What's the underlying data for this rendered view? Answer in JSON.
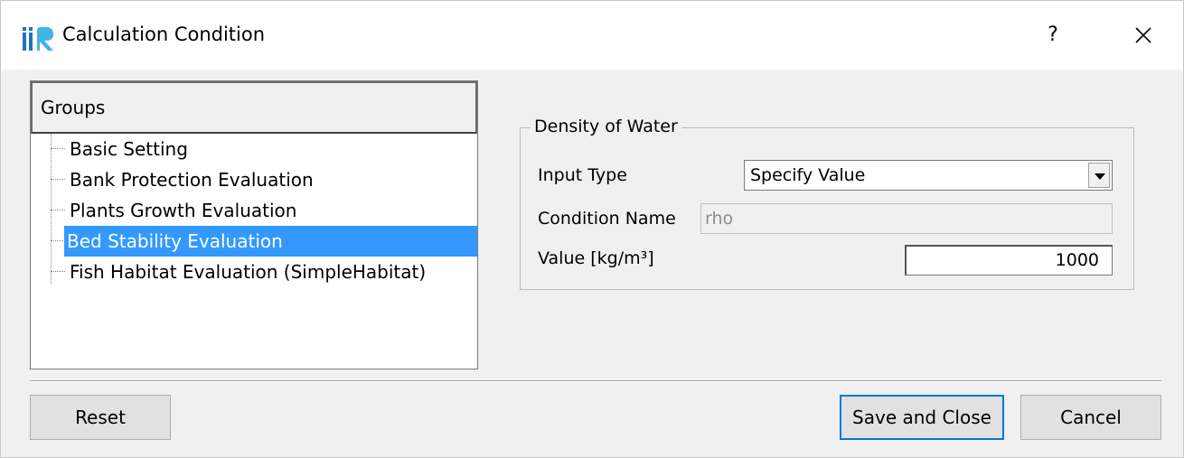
{
  "window": {
    "title": "Calculation Condition",
    "help_label": "?",
    "icons": {
      "app": "iric-logo-icon",
      "close": "close-icon"
    }
  },
  "groups": {
    "header": "Groups",
    "items": [
      {
        "label": "Basic Setting",
        "selected": false
      },
      {
        "label": "Bank Protection Evaluation",
        "selected": false
      },
      {
        "label": "Plants Growth Evaluation",
        "selected": false
      },
      {
        "label": "Bed Stability Evaluation",
        "selected": true
      },
      {
        "label": "Fish Habitat Evaluation (SimpleHabitat)",
        "selected": false
      }
    ]
  },
  "density": {
    "group_title": "Density of Water",
    "input_type_label": "Input Type",
    "input_type_value": "Specify Value",
    "condition_name_label": "Condition Name",
    "condition_name_value": "rho",
    "value_label": "Value [kg/m³]",
    "value": "1000"
  },
  "buttons": {
    "reset": "Reset",
    "save_close": "Save and Close",
    "cancel": "Cancel"
  },
  "colors": {
    "selection": "#3399ff",
    "default_button_border": "#0078d7",
    "logo_blue": "#1e73be",
    "logo_cyan": "#41b6e6"
  }
}
